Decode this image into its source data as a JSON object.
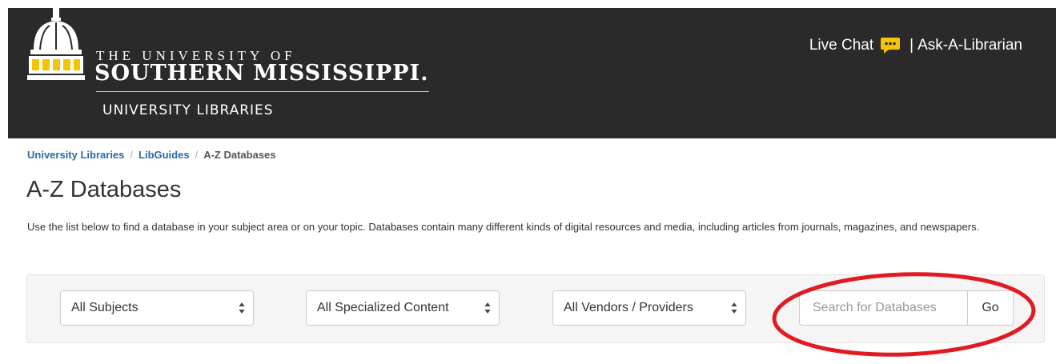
{
  "header": {
    "logo_line1": "THE UNIVERSITY OF",
    "logo_line2": "SOUTHERN MISSISSIPPI.",
    "logo_subtitle": "UNIVERSITY LIBRARIES",
    "live_chat_label": "Live Chat",
    "chat_icon": "speech-bubble-icon",
    "separator": "|",
    "ask_librarian_label": "Ask-A-Librarian",
    "accent_color": "#f5c400"
  },
  "breadcrumb": {
    "items": [
      "University Libraries",
      "LibGuides",
      "A-Z Databases"
    ],
    "separator": "/"
  },
  "page": {
    "title": "A-Z Databases",
    "intro": "Use the list below to find a database in your subject area or on your topic. Databases contain many different kinds of digital resources and media, including articles from journals, magazines, and newspapers."
  },
  "filters": {
    "subjects_selected": "All Subjects",
    "content_selected": "All Specialized Content",
    "vendors_selected": "All Vendors / Providers"
  },
  "search": {
    "placeholder": "Search for Databases",
    "value": "",
    "go_label": "Go"
  },
  "annotation": {
    "circle_color": "#e11b22"
  }
}
